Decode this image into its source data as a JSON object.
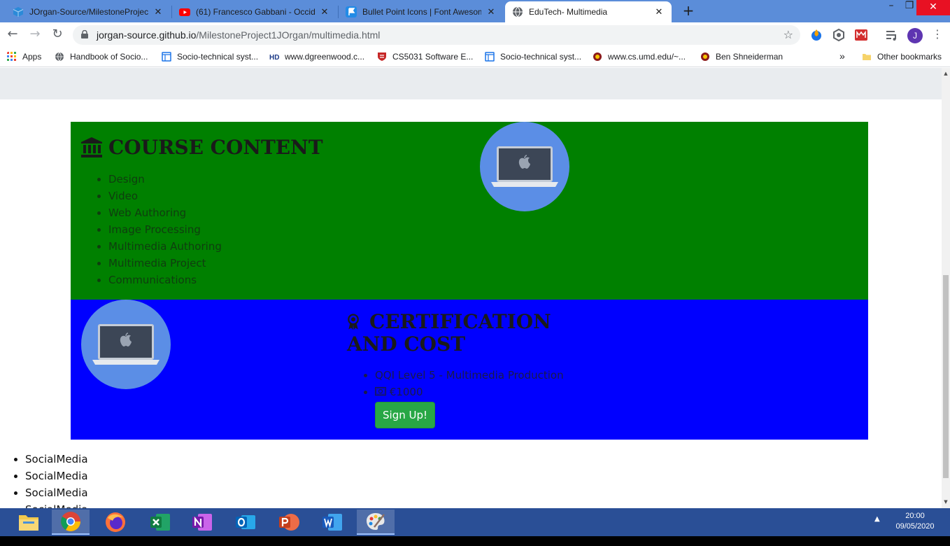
{
  "browser": {
    "tabs": [
      {
        "title": "JOrgan-Source/MilestoneProject",
        "icon": "cube-icon",
        "color": "#2b8ad8"
      },
      {
        "title": "(61) Francesco Gabbani - Occide",
        "icon": "youtube-icon",
        "color": "#ff0000"
      },
      {
        "title": "Bullet Point Icons | Font Awesom",
        "icon": "flag-icon",
        "color": "#228be6"
      },
      {
        "title": "EduTech- Multimedia",
        "icon": "globe-icon",
        "color": "#5f6368"
      }
    ],
    "new_tab_label": "+",
    "url_host": "jorgan-source.github.io",
    "url_path": "/MilestoneProject1JOrgan/multimedia.html",
    "profile_initial": "J"
  },
  "bookmarks": {
    "apps_label": "Apps",
    "items": [
      "Handbook of Socio...",
      "Socio-technical syst...",
      "www.dgreenwood.c...",
      "CS5031 Software E...",
      "Socio-technical syst...",
      "www.cs.umd.edu/~...",
      "Ben Shneiderman"
    ],
    "overflow": "»",
    "other": "Other bookmarks"
  },
  "page": {
    "course": {
      "icon": "university-icon",
      "heading": "COURSE CONTENT",
      "items": [
        "Design",
        "Video",
        "Web Authoring",
        "Image Processing",
        "Multimedia Authoring",
        "Multimedia Project",
        "Communications"
      ],
      "bg": "#008000",
      "image": "laptop-icon"
    },
    "cert": {
      "icon": "award-icon",
      "heading_line1": "CERTIFICATION",
      "heading_line2": "AND COST",
      "items": [
        "QQI Level 5 - Multimedia Production",
        "€1000"
      ],
      "cost_icon": "money-bill-icon",
      "button": "Sign Up!",
      "bg": "#0000ff",
      "button_color": "#28a745"
    },
    "social": [
      "SocialMedia",
      "SocialMedia",
      "SocialMedia",
      "SocialMedia"
    ]
  },
  "taskbar": {
    "apps": [
      "file-explorer-icon",
      "chrome-icon",
      "firefox-icon",
      "excel-icon",
      "onenote-icon",
      "outlook-icon",
      "powerpoint-icon",
      "word-icon",
      "paint-icon"
    ],
    "time": "20:00",
    "date": "09/05/2020"
  }
}
